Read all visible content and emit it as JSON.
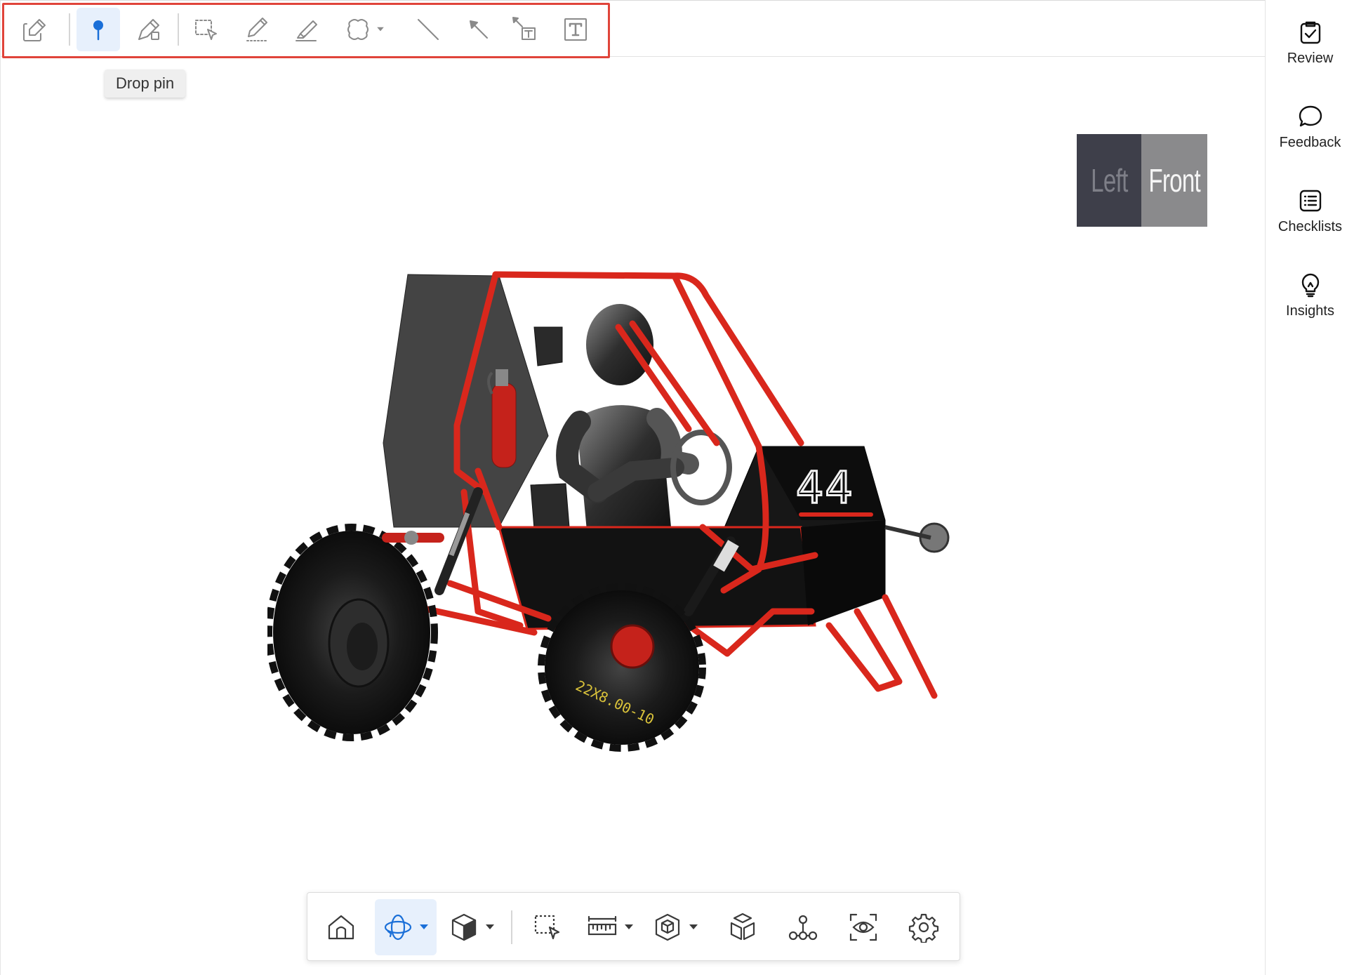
{
  "markup_toolbar": {
    "tools": [
      {
        "name": "markup-edit",
        "icon": "pencil-square-icon"
      },
      {
        "name": "drop-pin",
        "icon": "pin-icon",
        "active": true
      },
      {
        "name": "pen-shape",
        "icon": "pen-shape-icon"
      },
      {
        "name": "select-area",
        "icon": "select-cursor-icon"
      },
      {
        "name": "pencil",
        "icon": "pencil-icon"
      },
      {
        "name": "highlighter",
        "icon": "highlighter-icon"
      },
      {
        "name": "cloud-shape",
        "icon": "cloud-icon",
        "has_dropdown": true
      },
      {
        "name": "line",
        "icon": "line-icon"
      },
      {
        "name": "arrow",
        "icon": "arrow-icon"
      },
      {
        "name": "callout-text",
        "icon": "callout-text-icon"
      },
      {
        "name": "text",
        "icon": "text-box-icon"
      }
    ],
    "tooltip": "Drop pin",
    "accent_color": "#1a6fd8",
    "highlight_color": "#e0443a"
  },
  "view_cube": {
    "left_label": "Left",
    "front_label": "Front"
  },
  "model": {
    "car_number": "44",
    "tire_text": "22X8.00-10",
    "frame_color": "#d9271c"
  },
  "bottom_toolbar": {
    "tools": [
      {
        "name": "home",
        "icon": "home-icon"
      },
      {
        "name": "orbit",
        "icon": "orbit-icon",
        "active": true,
        "has_dropdown": true
      },
      {
        "name": "view-cube",
        "icon": "cube-icon",
        "has_dropdown": true
      },
      {
        "name": "select",
        "icon": "select-cursor-icon"
      },
      {
        "name": "measure",
        "icon": "ruler-icon",
        "has_dropdown": true
      },
      {
        "name": "section",
        "icon": "section-cube-icon",
        "has_dropdown": true
      },
      {
        "name": "explode",
        "icon": "explode-icon"
      },
      {
        "name": "model-browser",
        "icon": "tree-icon"
      },
      {
        "name": "visibility",
        "icon": "eye-frame-icon"
      },
      {
        "name": "settings",
        "icon": "gear-icon"
      }
    ]
  },
  "sidebar": {
    "items": [
      {
        "label": "Review",
        "icon": "clipboard-check-icon"
      },
      {
        "label": "Feedback",
        "icon": "speech-bubble-icon"
      },
      {
        "label": "Checklists",
        "icon": "list-icon"
      },
      {
        "label": "Insights",
        "icon": "lightbulb-icon"
      }
    ]
  }
}
